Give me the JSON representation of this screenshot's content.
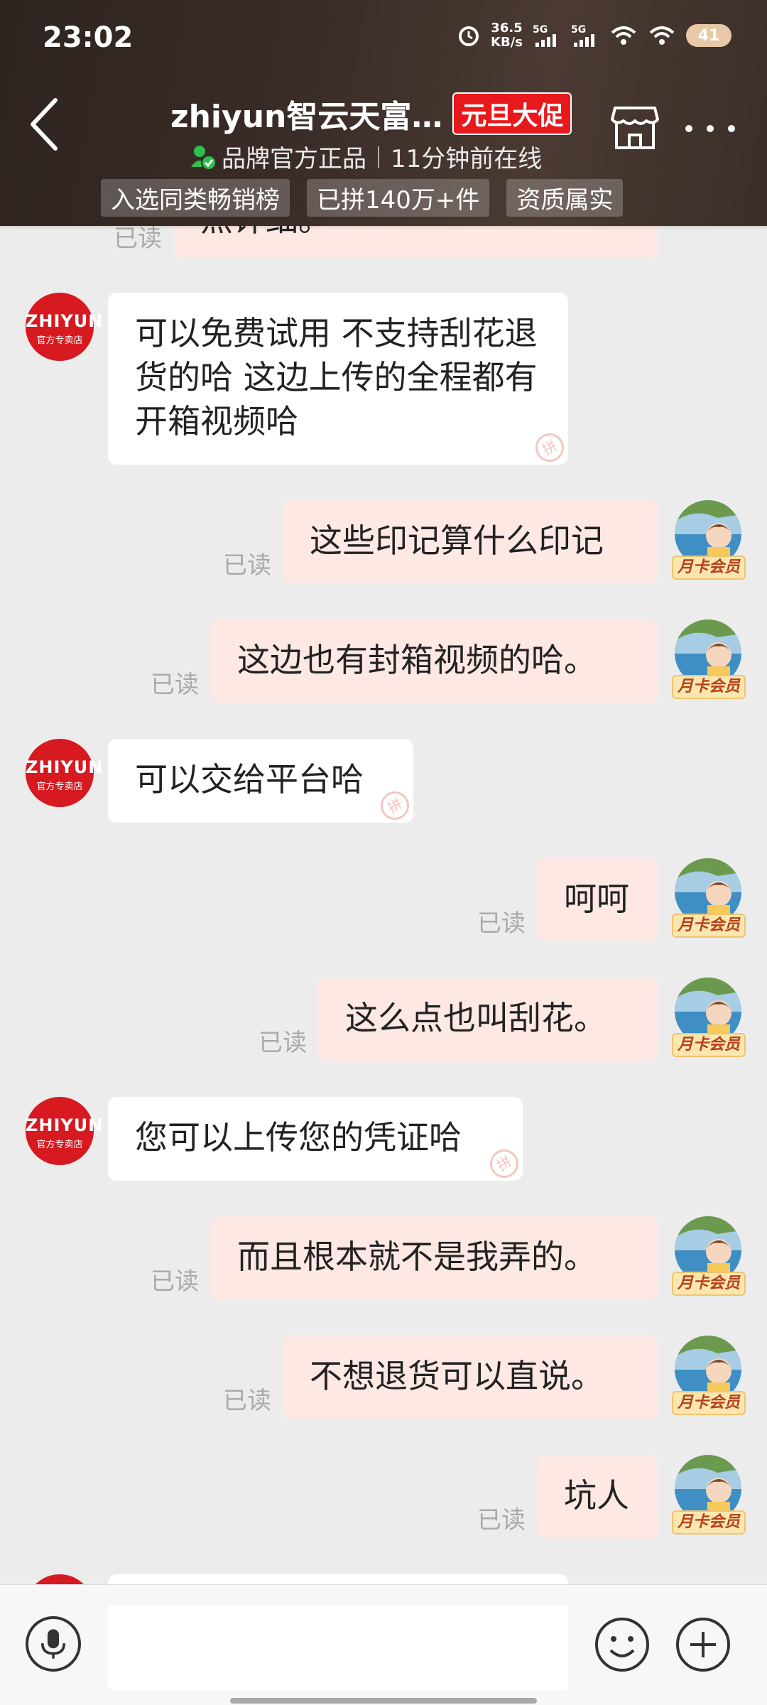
{
  "status_bar": {
    "time": "23:02",
    "net_speed_value": "36.5",
    "net_speed_unit": "KB/s",
    "sim1_label": "5G",
    "sim2_label": "5G",
    "battery": "41"
  },
  "header": {
    "title": "zhiyun智云天富…",
    "promo_badge": "元旦大促",
    "brand_label": "品牌官方正品",
    "online_status": "11分钟前在线",
    "tags": [
      "入选同类畅销榜",
      "已拼140万+件",
      "资质属实"
    ]
  },
  "shop": {
    "avatar_line1": "ZHIYUN",
    "avatar_line2": "官方专卖店"
  },
  "user": {
    "member_badge": "月卡会员"
  },
  "read_label": "已读",
  "messages": [
    {
      "side": "right",
      "text": "点详细。"
    },
    {
      "side": "left",
      "text": "可以免费试用 不支持刮花退货的哈 这边上传的全程都有开箱视频哈"
    },
    {
      "side": "right",
      "text": "这些印记算什么印记"
    },
    {
      "side": "right",
      "text": "这边也有封箱视频的哈。"
    },
    {
      "side": "left",
      "text": "可以交给平台哈"
    },
    {
      "side": "right",
      "text": "呵呵"
    },
    {
      "side": "right",
      "text": "这么点也叫刮花。"
    },
    {
      "side": "left",
      "text": "您可以上传您的凭证哈"
    },
    {
      "side": "right",
      "text": "而且根本就不是我弄的。"
    },
    {
      "side": "right",
      "text": "不想退货可以直说。"
    },
    {
      "side": "right",
      "text": "坑人"
    }
  ],
  "input": {
    "placeholder": ""
  },
  "watermark_glyph": "拼"
}
